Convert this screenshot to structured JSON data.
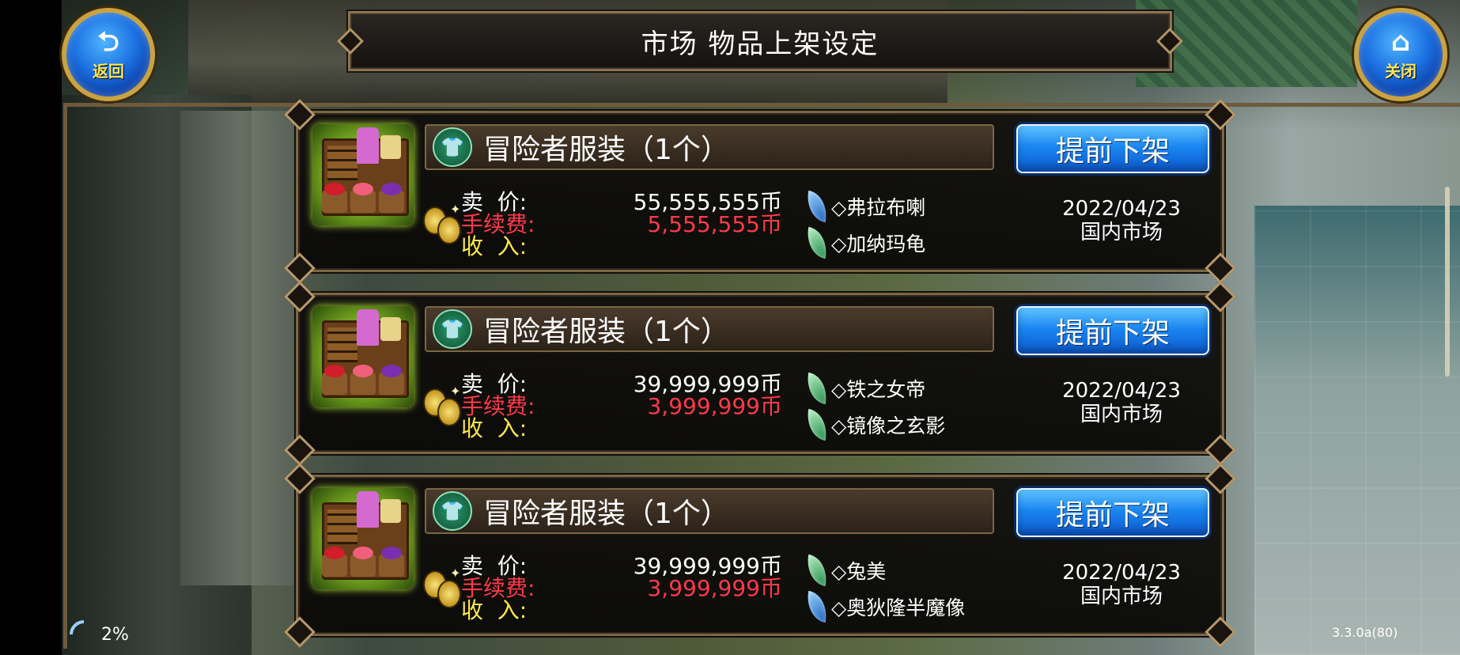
{
  "header": {
    "title": "市场 物品上架设定",
    "back_label": "返回",
    "close_label": "关闭"
  },
  "listings": [
    {
      "name": "冒险者服装（1个）",
      "unlist_label": "提前下架",
      "price_label": "卖  价:",
      "price": "55,555,555币",
      "fee_label": "手续费:",
      "fee": "5,555,555币",
      "income_label": "收  入:",
      "sellers": [
        {
          "icon": "blue-leaf-icon",
          "name": "◇弗拉布喇"
        },
        {
          "icon": "green-leaf-icon",
          "name": "◇加纳玛龟"
        }
      ],
      "date": "2022/04/23",
      "market": "国内市场"
    },
    {
      "name": "冒险者服装（1个）",
      "unlist_label": "提前下架",
      "price_label": "卖  价:",
      "price": "39,999,999币",
      "fee_label": "手续费:",
      "fee": "3,999,999币",
      "income_label": "收  入:",
      "sellers": [
        {
          "icon": "green-leaf-icon",
          "name": "◇铁之女帝"
        },
        {
          "icon": "green-leaf-icon",
          "name": "◇镜像之玄影"
        }
      ],
      "date": "2022/04/23",
      "market": "国内市场"
    },
    {
      "name": "冒险者服装（1个）",
      "unlist_label": "提前下架",
      "price_label": "卖  价:",
      "price": "39,999,999币",
      "fee_label": "手续费:",
      "fee": "3,999,999币",
      "income_label": "收  入:",
      "sellers": [
        {
          "icon": "green-leaf-icon",
          "name": "◇兔美"
        },
        {
          "icon": "blue-leaf-icon",
          "name": "◇奥狄隆半魔像"
        }
      ],
      "date": "2022/04/23",
      "market": "国内市场"
    }
  ],
  "footer": {
    "signal": "2%",
    "version": "3.3.0a(80)"
  },
  "colors": {
    "button_blue": "#1a86f0",
    "fee_red": "#ff3a4a",
    "income_yellow": "#ffe94a",
    "frame_gold": "#c9a341"
  }
}
